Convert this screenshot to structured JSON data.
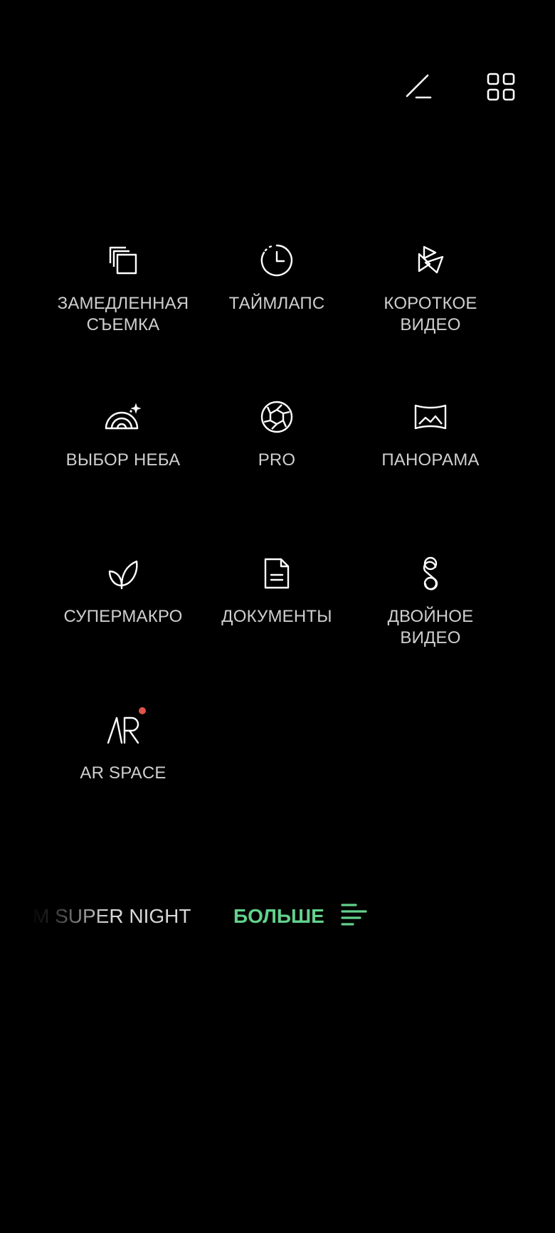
{
  "top_bar": {
    "edit_icon": "edit-pencil-icon",
    "grid_icon": "grid-icon"
  },
  "modes": [
    {
      "id": "slow-motion",
      "label": "ЗАМЕДЛЕННАЯ\nСЪЕМКА",
      "icon": "slow-motion-icon"
    },
    {
      "id": "timelapse",
      "label": "ТАЙМЛАПС",
      "icon": "timelapse-icon"
    },
    {
      "id": "short-video",
      "label": "КОРОТКОЕ\nВИДЕО",
      "icon": "short-video-icon"
    },
    {
      "id": "sky-select",
      "label": "ВЫБОР НЕБА",
      "icon": "sky-icon"
    },
    {
      "id": "pro",
      "label": "PRO",
      "icon": "aperture-icon"
    },
    {
      "id": "panorama",
      "label": "ПАНОРАМА",
      "icon": "panorama-icon"
    },
    {
      "id": "supermacro",
      "label": "СУПЕРМАКРО",
      "icon": "leaf-icon"
    },
    {
      "id": "documents",
      "label": "ДОКУМЕНТЫ",
      "icon": "document-icon"
    },
    {
      "id": "dual-video",
      "label": "ДВОЙНОЕ\nВИДЕО",
      "icon": "dual-video-icon"
    },
    {
      "id": "ar-space",
      "label": "AR SPACE",
      "icon": "ar-icon",
      "new_badge": true
    }
  ],
  "bottom_bar": {
    "prev_mode_label": "M SUPER NIGHT",
    "more_label": "БОЛЬШЕ",
    "more_icon": "menu-lines-icon",
    "accent_color": "#63d18c"
  }
}
